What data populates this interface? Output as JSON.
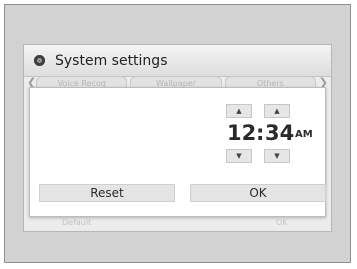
{
  "header": {
    "title": "System settings",
    "title_icon": "gear-icon"
  },
  "tabs": [
    {
      "label": "Voice Recog"
    },
    {
      "label": "Wallpaper"
    },
    {
      "label": "Others"
    }
  ],
  "clock": {
    "hour": "12",
    "separator": ":",
    "minute": "34",
    "period": "AM",
    "up_glyph": "▲",
    "down_glyph": "▼"
  },
  "dialog_buttons": {
    "reset": "Reset",
    "ok": "OK"
  },
  "footer_buttons": {
    "default": "Default",
    "ok": "OK"
  },
  "colors": {
    "screen_bg": "#ececec",
    "dialog_bg": "#ffffff",
    "button_bg": "#e4e4e4",
    "text": "#2a2a2a"
  }
}
